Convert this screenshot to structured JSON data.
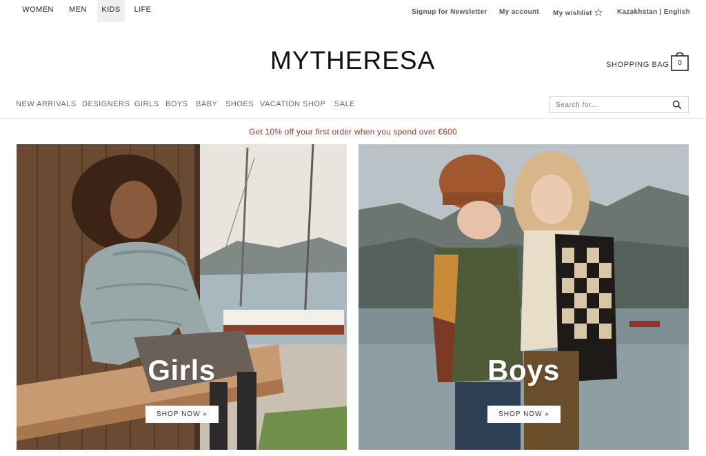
{
  "top_nav": {
    "departments": [
      {
        "label": "WOMEN",
        "active": false
      },
      {
        "label": "MEN",
        "active": false
      },
      {
        "label": "KIDS",
        "active": true
      },
      {
        "label": "LIFE",
        "active": false
      }
    ],
    "utility": {
      "newsletter": "Signup for Newsletter",
      "account": "My account",
      "wishlist": "My wishlist",
      "wishlist_icon": "star-icon",
      "locale": "Kazakhstan | English"
    }
  },
  "header": {
    "logo": "MYTHERESA",
    "bag_label": "SHOPPING BAG",
    "bag_count": "0",
    "bag_icon": "shopping-bag-icon"
  },
  "category_nav": {
    "items": [
      "NEW ARRIVALS",
      "DESIGNERS",
      "GIRLS",
      "BOYS",
      "BABY",
      "SHOES",
      "VACATION SHOP",
      "SALE"
    ]
  },
  "search": {
    "placeholder": "Search for...",
    "icon": "search-icon"
  },
  "promo": {
    "text": "Get 10% off your first order when you spend over €600",
    "color": "#9a3a2c"
  },
  "tiles": [
    {
      "title": "Girls",
      "button": "SHOP NOW »"
    },
    {
      "title": "Boys",
      "button": "SHOP NOW »"
    }
  ]
}
